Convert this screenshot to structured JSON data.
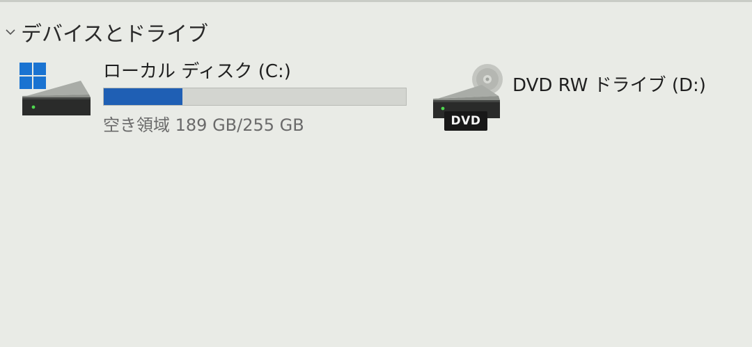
{
  "section": {
    "title": "デバイスとドライブ",
    "expanded": true
  },
  "drives": [
    {
      "name": "ローカル ディスク (C:)",
      "free_text": "空き領域 189 GB/255 GB",
      "free_gb": 189,
      "total_gb": 255,
      "used_fraction": 0.26,
      "bar_color": "#1f5fb4",
      "icon": "windows-drive-icon"
    },
    {
      "name": "DVD RW ドライブ (D:)",
      "badge": "DVD",
      "icon": "dvd-drive-icon"
    }
  ]
}
